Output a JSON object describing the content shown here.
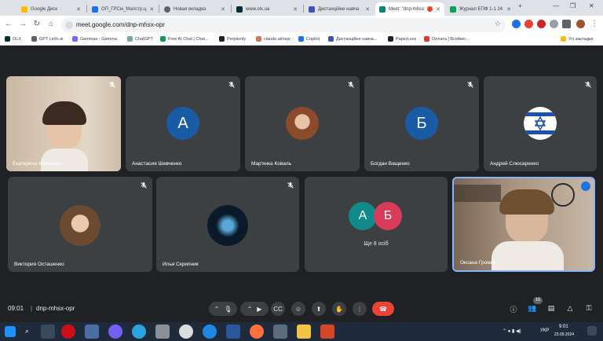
{
  "tabs": [
    {
      "title": "Google Диск",
      "color": "#fbbc04"
    },
    {
      "title": "ОП_ГРСм_Магістр.ц",
      "color": "#1a73e8"
    },
    {
      "title": "Новая вкладка",
      "color": "#5f6368"
    },
    {
      "title": "www.olx.ua",
      "color": "#002f34"
    },
    {
      "title": "Дистанційне навча",
      "color": "#3f51b5"
    },
    {
      "title": "Meet: \"dnp-mhsx",
      "color": "#00897b"
    },
    {
      "title": "Журнал ЕПФ 1-1 24",
      "color": "#0f9d58"
    }
  ],
  "window": {
    "minimize": "—",
    "maximize": "❐",
    "close": "✕",
    "newtab": "+"
  },
  "address": {
    "url": "meet.google.com/dnp-mhsx-opr"
  },
  "bookmarks": [
    {
      "label": "OLX",
      "color": "#002f34"
    },
    {
      "label": "GPT Linfo.ai",
      "color": "#5f6368"
    },
    {
      "label": "Gammas - Gamma",
      "color": "#7b61ff"
    },
    {
      "label": "ChatGPT",
      "color": "#74aa9c"
    },
    {
      "label": "Free AI Chat | Chat...",
      "color": "#0f9d58"
    },
    {
      "label": "Perplexity",
      "color": "#202124"
    },
    {
      "label": "claude.ai/new",
      "color": "#cc785c"
    },
    {
      "label": "Copilot",
      "color": "#1a73e8"
    },
    {
      "label": "Дистанційне навча...",
      "color": "#3f51b5"
    },
    {
      "label": "PaperLess",
      "color": "#202124"
    },
    {
      "label": "Оплата | Всеймо...",
      "color": "#e53935"
    }
  ],
  "bookmarks_all": "Усі закладки",
  "participants": [
    {
      "name": "Екатерина Каменько",
      "avatar": "",
      "color": "",
      "video": true
    },
    {
      "name": "Анастасия Шевченко",
      "avatar": "А",
      "color": "#1a5ba6",
      "video": false
    },
    {
      "name": "Мар'янка Коваль",
      "avatar": "",
      "color": "",
      "video": false
    },
    {
      "name": "Богдан Ващенко",
      "avatar": "Б",
      "color": "#1a5ba6",
      "video": false
    },
    {
      "name": "Андрей Слюсаренко",
      "avatar": "",
      "color": "",
      "video": false
    },
    {
      "name": "Виктория Осташенко",
      "avatar": "",
      "color": "",
      "video": false
    },
    {
      "name": "Илья Скрипник",
      "avatar": "",
      "color": "",
      "video": false
    },
    {
      "name": "Оксана Громик",
      "avatar": "",
      "color": "",
      "video": true
    }
  ],
  "more": {
    "label": "Ще 8 осіб",
    "a1": "А",
    "c1": "#128a8a",
    "a2": "Б",
    "c2": "#d93b5a"
  },
  "meeting": {
    "time": "09:01",
    "code": "dnp-mhsx-opr",
    "participant_count": "16"
  },
  "tray": {
    "lang": "УКР",
    "time": "9:01",
    "date": "23.09.2024"
  }
}
